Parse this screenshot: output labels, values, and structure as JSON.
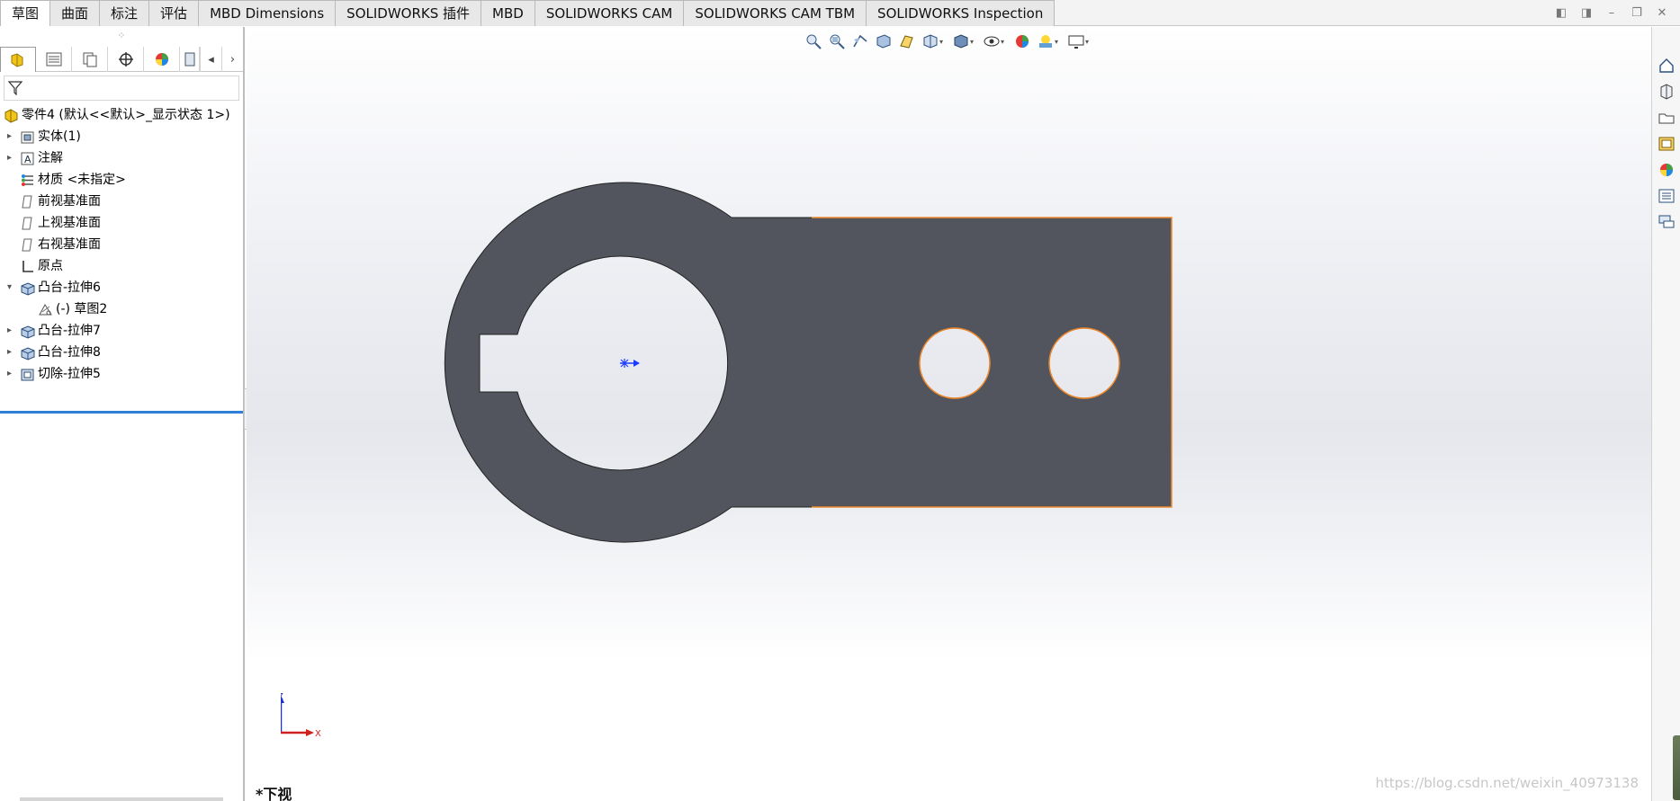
{
  "tabs": [
    {
      "label": "草图",
      "active": true
    },
    {
      "label": "曲面",
      "active": false
    },
    {
      "label": "标注",
      "active": false
    },
    {
      "label": "评估",
      "active": false
    },
    {
      "label": "MBD Dimensions",
      "active": false
    },
    {
      "label": "SOLIDWORKS 插件",
      "active": false
    },
    {
      "label": "MBD",
      "active": false
    },
    {
      "label": "SOLIDWORKS CAM",
      "active": false
    },
    {
      "label": "SOLIDWORKS CAM TBM",
      "active": false
    },
    {
      "label": "SOLIDWORKS Inspection",
      "active": false
    }
  ],
  "window_controls": {
    "restore_left": "◧",
    "restore_right": "◨",
    "minimize": "–",
    "maximize": "❐",
    "close": "✕"
  },
  "feature_panel": {
    "grip": "⁘",
    "tab_icons": [
      "featuremanager-icon",
      "propertymanager-icon",
      "configurationmanager-icon",
      "dimxpertmanager-icon",
      "displaymanager-icon",
      "camworks-icon"
    ],
    "nav_prev": "◂",
    "nav_next": "›",
    "filter_placeholder": ""
  },
  "tree": [
    {
      "label": "零件4  (默认<<默认>_显示状态 1>)",
      "icon": "part-icon",
      "expander": "",
      "indent": 0
    },
    {
      "label": "实体(1)",
      "icon": "solid-bodies-icon",
      "expander": "▸",
      "indent": 1
    },
    {
      "label": "注解",
      "icon": "annotations-icon",
      "expander": "▸",
      "indent": 1
    },
    {
      "label": "材质 <未指定>",
      "icon": "material-icon",
      "expander": "",
      "indent": 1
    },
    {
      "label": "前视基准面",
      "icon": "plane-icon",
      "expander": "",
      "indent": 1
    },
    {
      "label": "上视基准面",
      "icon": "plane-icon",
      "expander": "",
      "indent": 1
    },
    {
      "label": "右视基准面",
      "icon": "plane-icon",
      "expander": "",
      "indent": 1
    },
    {
      "label": "原点",
      "icon": "origin-icon",
      "expander": "",
      "indent": 1
    },
    {
      "label": "凸台-拉伸6",
      "icon": "boss-extrude-icon",
      "expander": "▾",
      "indent": 1
    },
    {
      "label": "(-) 草图2",
      "icon": "sketch-icon",
      "expander": "",
      "indent": 2
    },
    {
      "label": "凸台-拉伸7",
      "icon": "boss-extrude-icon",
      "expander": "▸",
      "indent": 1
    },
    {
      "label": "凸台-拉伸8",
      "icon": "boss-extrude-icon",
      "expander": "▸",
      "indent": 1
    },
    {
      "label": "切除-拉伸5",
      "icon": "cut-extrude-icon",
      "expander": "▸",
      "indent": 1
    }
  ],
  "viewport": {
    "view_name": "*下视",
    "triad": {
      "z_label": "Z",
      "x_label": "X"
    },
    "watermark": "https://blog.csdn.net/weixin_40973138",
    "heads_up_toolbar": [
      "zoom-to-fit-icon",
      "zoom-to-area-icon",
      "previous-view-icon",
      "section-view-icon",
      "dynamic-annotation-icon",
      "view-orientation-icon",
      "display-style-icon",
      "hide-show-items-icon",
      "edit-appearance-icon",
      "apply-scene-icon",
      "view-settings-icon"
    ]
  },
  "task_pane": [
    "solidworks-resources-icon",
    "design-library-icon",
    "file-explorer-icon",
    "view-palette-icon",
    "appearances-icon",
    "custom-properties-icon",
    "forum-icon"
  ],
  "colors": {
    "part_fill": "#53555e",
    "edge_highlight": "#f0882a",
    "active_tab_bg": "#ffffff",
    "tree_selection": "#2f7fd8"
  }
}
